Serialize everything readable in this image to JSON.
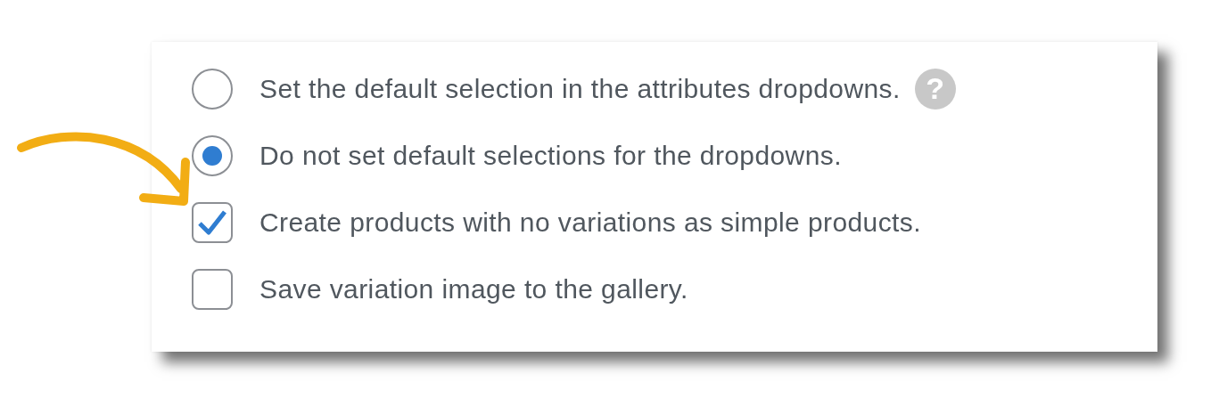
{
  "options": [
    {
      "kind": "radio",
      "label": "Set the default selection in the attributes dropdowns.",
      "selected": false,
      "help": "?"
    },
    {
      "kind": "radio",
      "label": "Do not set default selections for the dropdowns.",
      "selected": true
    },
    {
      "kind": "checkbox",
      "label": "Create products with no variations as simple products.",
      "checked": true
    },
    {
      "kind": "checkbox",
      "label": "Save variation image to the gallery.",
      "checked": false
    }
  ]
}
